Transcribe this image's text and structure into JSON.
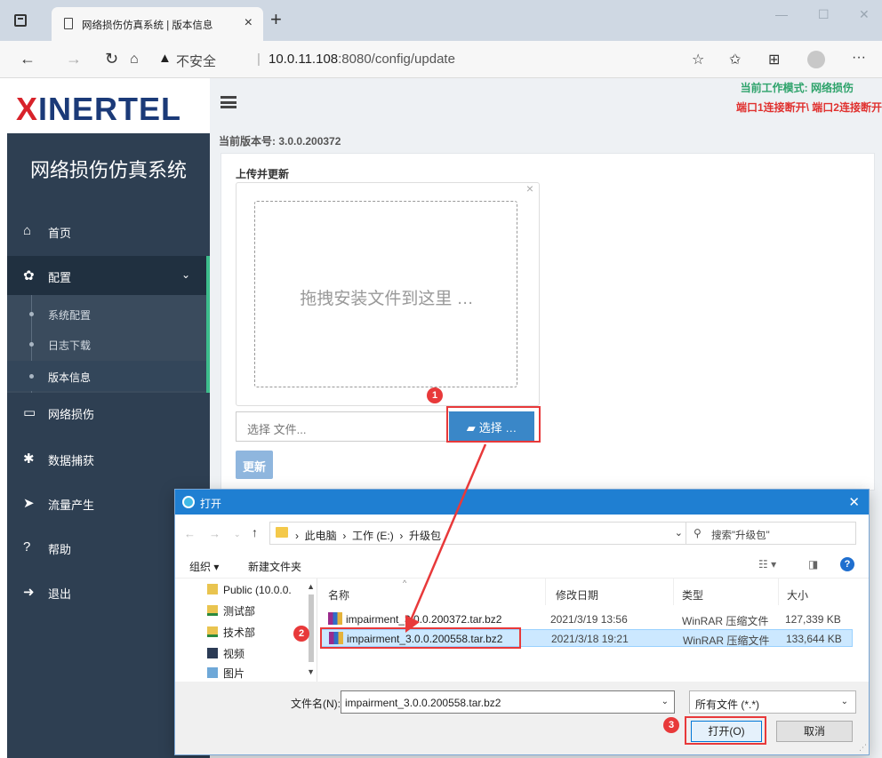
{
  "browser": {
    "tab_title": "网络损伤仿真系统 | 版本信息",
    "tab_close": "×",
    "new_tab": "+",
    "insecure_label": "不安全",
    "url_host": "10.0.11.108",
    "url_rest": ":8080/config/update",
    "window_controls": {
      "minimize": "—",
      "maximize": "☐",
      "close": "✕"
    }
  },
  "sidebar": {
    "logo_x": "X",
    "logo_rest": "INERTEL",
    "app_title": "网络损伤仿真系统",
    "items": [
      {
        "label": "首页",
        "icon": "home-icon",
        "glyph": "⌂"
      },
      {
        "label": "配置",
        "icon": "gear-icon",
        "glyph": "✿"
      },
      {
        "label": "网络损伤",
        "icon": "monitor-icon",
        "glyph": "▭"
      },
      {
        "label": "数据捕获",
        "icon": "bug-icon",
        "glyph": "✱"
      },
      {
        "label": "流量产生",
        "icon": "paper-plane-icon",
        "glyph": "➤"
      },
      {
        "label": "帮助",
        "icon": "help-icon",
        "glyph": "?"
      },
      {
        "label": "退出",
        "icon": "logout-icon",
        "glyph": "➜"
      }
    ],
    "submenu": [
      "系统配置",
      "日志下载",
      "版本信息"
    ],
    "caret": "⌄"
  },
  "main": {
    "mode": "当前工作模式: 网络损伤",
    "port_status": "端口1连接断开\\ 端口2连接断开",
    "version": "当前版本号: 3.0.0.200372",
    "panel_title": "上传并更新",
    "dropzone_close": "×",
    "dropzone_text": "拖拽安装文件到这里 …",
    "file_placeholder": "选择 文件...",
    "choose_label": "选择 …",
    "update_label": "更新"
  },
  "annotations": {
    "step1": "1",
    "step2": "2",
    "step3": "3",
    "accent": "#e8393a"
  },
  "dialog": {
    "title": "打开",
    "close": "✕",
    "path": [
      "此电脑",
      "工作 (E:)",
      "升级包"
    ],
    "search_placeholder": "搜索\"升级包\"",
    "organize": "组织 ▾",
    "new_folder": "新建文件夹",
    "tree": [
      "Public (10.0.0.",
      "测试部",
      "技术部",
      "视频",
      "图片"
    ],
    "columns": [
      "名称",
      "修改日期",
      "类型",
      "大小"
    ],
    "files": [
      {
        "name": "impairment_3.0.0.200372.tar.bz2",
        "date": "2021/3/19 13:56",
        "type": "WinRAR 压缩文件",
        "size": "127,339 KB"
      },
      {
        "name": "impairment_3.0.0.200558.tar.bz2",
        "date": "2021/3/18 19:21",
        "type": "WinRAR 压缩文件",
        "size": "133,644 KB"
      }
    ],
    "filename_label": "文件名(N):",
    "filename_value": "impairment_3.0.0.200558.tar.bz2",
    "filter": "所有文件 (*.*)",
    "open_label": "打开(O)",
    "cancel_label": "取消"
  }
}
